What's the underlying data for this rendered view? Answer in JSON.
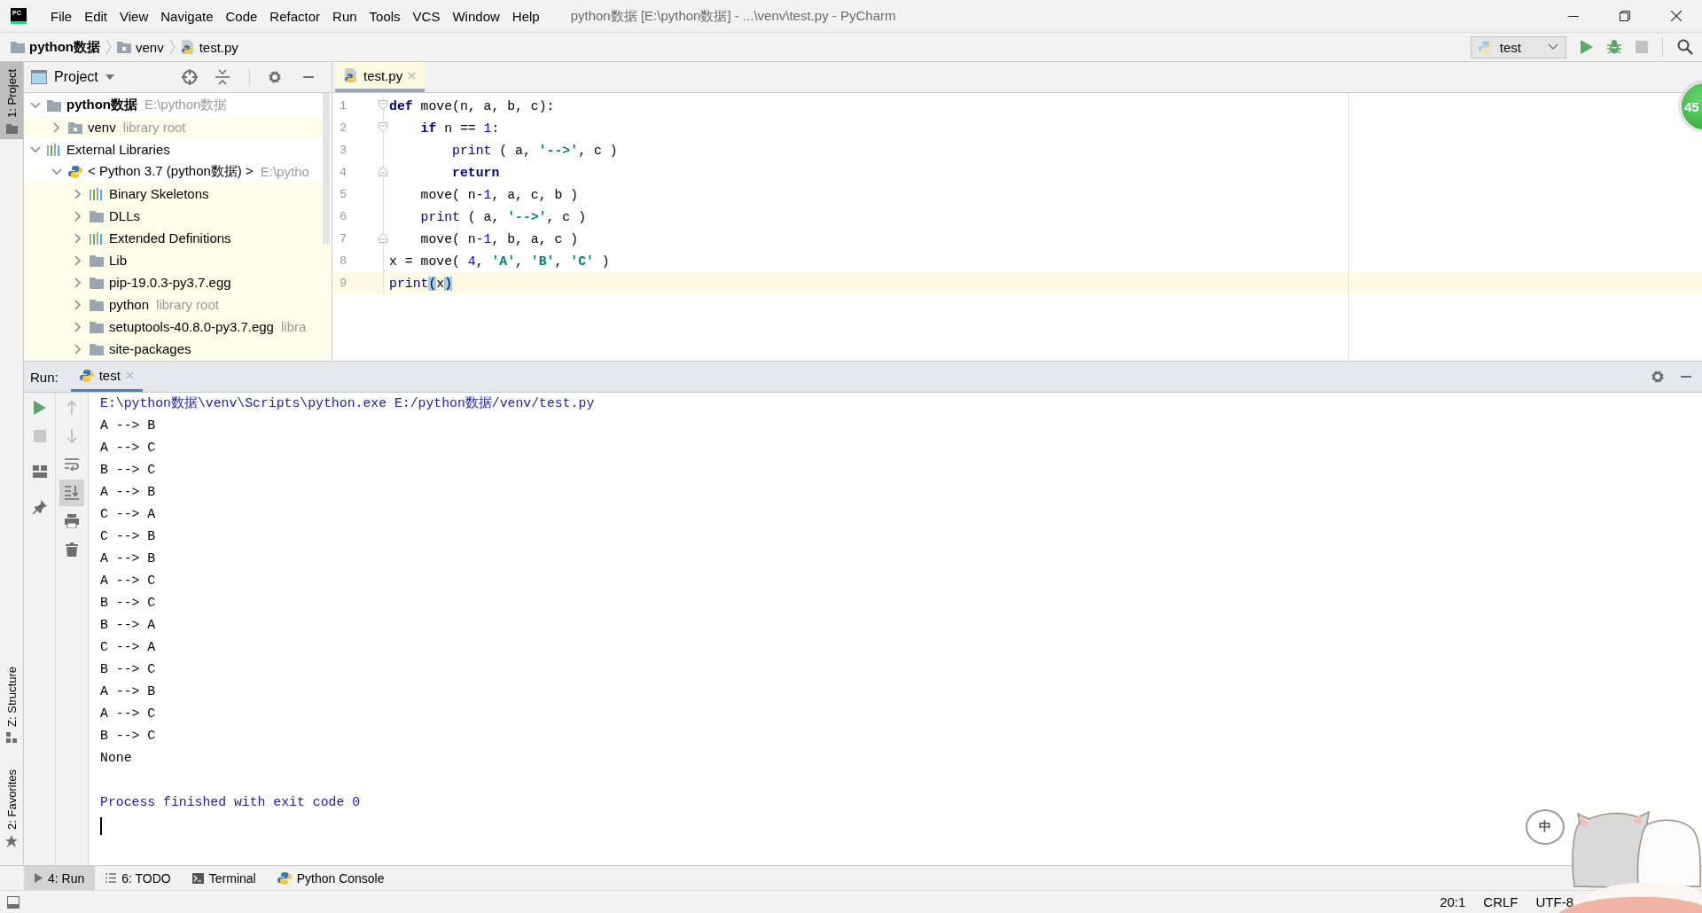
{
  "app_logo": "PC",
  "menu": [
    "File",
    "Edit",
    "View",
    "Navigate",
    "Code",
    "Refactor",
    "Run",
    "Tools",
    "VCS",
    "Window",
    "Help"
  ],
  "window_title": "python数据 [E:\\python数据] - ...\\venv\\test.py - PyCharm",
  "breadcrumbs": [
    {
      "label": "python数据",
      "kind": "project"
    },
    {
      "label": "venv",
      "kind": "source-folder"
    },
    {
      "label": "test.py",
      "kind": "python-file"
    }
  ],
  "run_config": "test",
  "left_strip_top": [
    {
      "label": "1: Project",
      "selected": true
    }
  ],
  "left_strip_bottom": [
    {
      "label": "Z: Structure",
      "selected": false
    },
    {
      "label": "2: Favorites",
      "selected": false
    }
  ],
  "project_panel": {
    "title": "Project",
    "tree": [
      {
        "label": "python数据",
        "hint": "E:\\python数据",
        "kind": "project",
        "expanded": true,
        "library": false,
        "children": [
          {
            "label": "venv",
            "hint": "library root",
            "kind": "source-folder",
            "expanded": false,
            "library": true
          }
        ]
      },
      {
        "label": "External Libraries",
        "kind": "libraries",
        "expanded": true,
        "library": false,
        "children": [
          {
            "label": "< Python 3.7 (python数据) >",
            "hint": "E:\\pytho",
            "kind": "sdk",
            "expanded": true,
            "library": false,
            "children": [
              {
                "label": "Binary Skeletons",
                "kind": "libraries",
                "expanded": false,
                "library": true
              },
              {
                "label": "DLLs",
                "kind": "folder",
                "expanded": false,
                "library": true
              },
              {
                "label": "Extended Definitions",
                "kind": "libraries",
                "expanded": false,
                "library": true
              },
              {
                "label": "Lib",
                "kind": "folder",
                "expanded": false,
                "library": true
              },
              {
                "label": "pip-19.0.3-py3.7.egg",
                "kind": "folder",
                "expanded": false,
                "library": true
              },
              {
                "label": "python",
                "hint": "library root",
                "kind": "folder",
                "expanded": false,
                "library": true
              },
              {
                "label": "setuptools-40.8.0-py3.7.egg",
                "hint": "libra",
                "kind": "folder",
                "expanded": false,
                "library": true
              },
              {
                "label": "site-packages",
                "kind": "folder",
                "expanded": false,
                "library": true
              }
            ]
          }
        ]
      }
    ]
  },
  "editor": {
    "tabs": [
      {
        "label": "test.py",
        "selected": true
      }
    ],
    "lines": [
      {
        "number": "1",
        "fold_start": true,
        "fold_end": false,
        "current": false,
        "tokens": [
          {
            "kind": "keyword",
            "text": "def"
          },
          {
            "kind": "plain",
            "text": " move(n, a, b, c):"
          }
        ]
      },
      {
        "number": "2",
        "fold_start": true,
        "fold_end": false,
        "current": false,
        "tokens": [
          {
            "kind": "keyword",
            "text": "    if"
          },
          {
            "kind": "plain",
            "text": " n == "
          },
          {
            "kind": "number",
            "text": "1"
          },
          {
            "kind": "plain",
            "text": ":"
          }
        ]
      },
      {
        "number": "3",
        "fold_start": false,
        "fold_end": false,
        "current": false,
        "tokens": [
          {
            "kind": "builtin",
            "text": "        print"
          },
          {
            "kind": "plain",
            "text": " ( a, "
          },
          {
            "kind": "string",
            "text": "'-->'"
          },
          {
            "kind": "plain",
            "text": ", c )"
          }
        ]
      },
      {
        "number": "4",
        "fold_start": false,
        "fold_end": true,
        "current": false,
        "tokens": [
          {
            "kind": "keyword",
            "text": "        return"
          }
        ]
      },
      {
        "number": "5",
        "fold_start": false,
        "fold_end": false,
        "current": false,
        "tokens": [
          {
            "kind": "plain",
            "text": "    move( n-"
          },
          {
            "kind": "number",
            "text": "1"
          },
          {
            "kind": "plain",
            "text": ", a, c, b )"
          }
        ]
      },
      {
        "number": "6",
        "fold_start": false,
        "fold_end": false,
        "current": false,
        "tokens": [
          {
            "kind": "builtin",
            "text": "    print"
          },
          {
            "kind": "plain",
            "text": " ( a, "
          },
          {
            "kind": "string",
            "text": "'-->'"
          },
          {
            "kind": "plain",
            "text": ", c )"
          }
        ]
      },
      {
        "number": "7",
        "fold_start": false,
        "fold_end": true,
        "current": false,
        "tokens": [
          {
            "kind": "plain",
            "text": "    move( n-"
          },
          {
            "kind": "number",
            "text": "1"
          },
          {
            "kind": "plain",
            "text": ", b, a, c )"
          }
        ]
      },
      {
        "number": "8",
        "fold_start": false,
        "fold_end": false,
        "current": false,
        "tokens": [
          {
            "kind": "plain",
            "text": "x = move( "
          },
          {
            "kind": "number",
            "text": "4"
          },
          {
            "kind": "plain",
            "text": ", "
          },
          {
            "kind": "string",
            "text": "'A'"
          },
          {
            "kind": "plain",
            "text": ", "
          },
          {
            "kind": "string",
            "text": "'B'"
          },
          {
            "kind": "plain",
            "text": ", "
          },
          {
            "kind": "string",
            "text": "'C'"
          },
          {
            "kind": "plain",
            "text": " )"
          }
        ]
      },
      {
        "number": "9",
        "fold_start": false,
        "fold_end": false,
        "current": true,
        "tokens": [
          {
            "kind": "builtin",
            "text": "print"
          },
          {
            "kind": "brace-match",
            "text": "("
          },
          {
            "kind": "plain",
            "text": "x"
          },
          {
            "kind": "brace-match",
            "text": ")"
          }
        ]
      }
    ],
    "badge": "45"
  },
  "run_panel": {
    "label": "Run:",
    "tabs": [
      {
        "label": "test",
        "selected": true
      }
    ],
    "output": [
      {
        "kind": "command",
        "text": "E:\\python数据\\venv\\Scripts\\python.exe E:/python数据/venv/test.py"
      },
      {
        "kind": "stdout",
        "text": "A --> B"
      },
      {
        "kind": "stdout",
        "text": "A --> C"
      },
      {
        "kind": "stdout",
        "text": "B --> C"
      },
      {
        "kind": "stdout",
        "text": "A --> B"
      },
      {
        "kind": "stdout",
        "text": "C --> A"
      },
      {
        "kind": "stdout",
        "text": "C --> B"
      },
      {
        "kind": "stdout",
        "text": "A --> B"
      },
      {
        "kind": "stdout",
        "text": "A --> C"
      },
      {
        "kind": "stdout",
        "text": "B --> C"
      },
      {
        "kind": "stdout",
        "text": "B --> A"
      },
      {
        "kind": "stdout",
        "text": "C --> A"
      },
      {
        "kind": "stdout",
        "text": "B --> C"
      },
      {
        "kind": "stdout",
        "text": "A --> B"
      },
      {
        "kind": "stdout",
        "text": "A --> C"
      },
      {
        "kind": "stdout",
        "text": "B --> C"
      },
      {
        "kind": "stdout",
        "text": "None"
      },
      {
        "kind": "system",
        "text": "Process finished with exit code 0"
      }
    ]
  },
  "bottom_tabs": [
    {
      "label": "4: Run",
      "kind": "run",
      "selected": true
    },
    {
      "label": "6: TODO",
      "kind": "todo",
      "selected": false
    },
    {
      "label": "Terminal",
      "kind": "terminal",
      "selected": false
    },
    {
      "label": "Python Console",
      "kind": "console",
      "selected": false
    }
  ],
  "status_bar": [
    "20:1",
    "CRLF",
    "UTF-8"
  ],
  "ime_indicator": "中"
}
